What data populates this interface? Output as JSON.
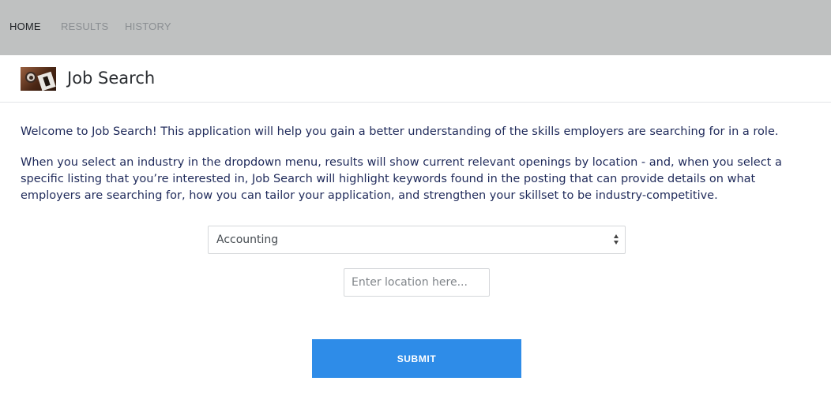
{
  "nav": {
    "items": [
      {
        "label": "HOME",
        "active": true
      },
      {
        "label": "RESULTS",
        "active": false
      },
      {
        "label": "HISTORY",
        "active": false
      }
    ]
  },
  "header": {
    "logo_icon": "job-search-logo-icon",
    "title": "Job Search"
  },
  "content": {
    "intro": "Welcome to Job Search! This application will help you gain a better understanding of the skills employers are searching for in a role.",
    "description": "When you select an industry in the dropdown menu, results will show current relevant openings by location - and, when you select a specific listing that you’re interested in, Job Search will highlight keywords found in the posting that can provide details on what employers are searching for, how you can tailor your application, and strengthen your skillset to be industry-competitive."
  },
  "form": {
    "industry_selected": "Accounting",
    "location_value": "",
    "location_placeholder": "Enter location here...",
    "submit_label": "SUBMIT"
  },
  "colors": {
    "nav_bg": "#bfc1c1",
    "accent": "#2e8ce8",
    "body_text": "#1f2a5a"
  }
}
